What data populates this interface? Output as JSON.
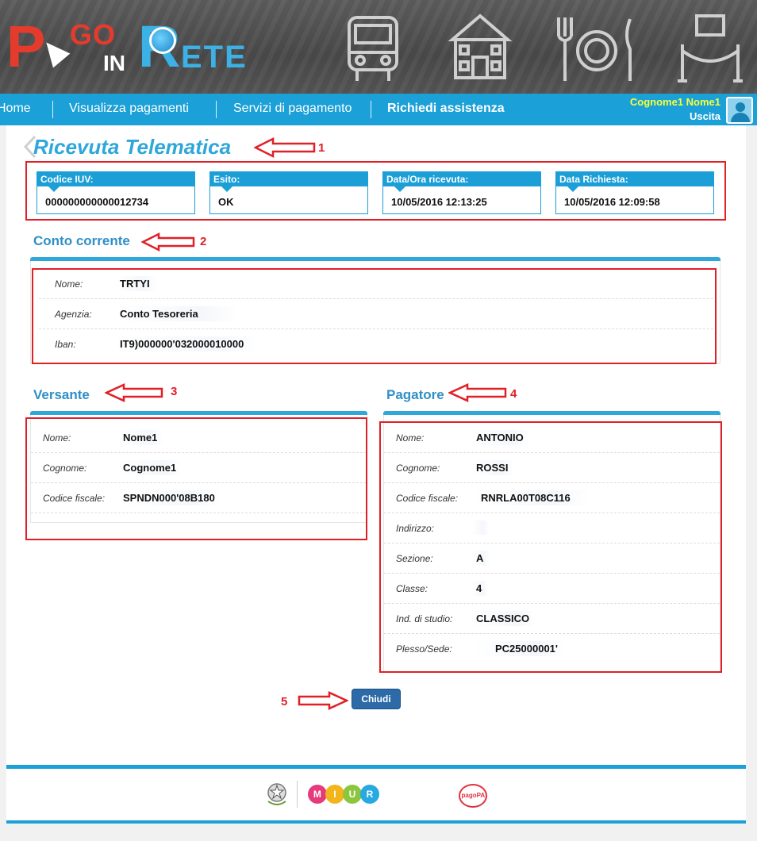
{
  "brand": {
    "p": "P",
    "go": "GO",
    "in": "IN",
    "r": "R",
    "ete": "ETE"
  },
  "nav": {
    "home": "Home",
    "visualizza": "Visualizza pagamenti",
    "servizi": "Servizi di pagamento",
    "assistenza": "Richiedi assistenza"
  },
  "user": {
    "name": "Cognome1 Nome1",
    "exit": "Uscita"
  },
  "page": {
    "title": "Ricevuta Telematica"
  },
  "summary": [
    {
      "label": "Codice IUV:",
      "value": "000000000000012734"
    },
    {
      "label": "Esito:",
      "value": "OK"
    },
    {
      "label": "Data/Ora ricevuta:",
      "value": "10/05/2016 12:13:25"
    },
    {
      "label": "Data Richiesta:",
      "value": "10/05/2016 12:09:58"
    }
  ],
  "conto": {
    "title": "Conto corrente",
    "rows": [
      {
        "label": "Nome:",
        "value": "TRTYI"
      },
      {
        "label": "Agenzia:",
        "value": "Conto Tesoreria"
      },
      {
        "label": "Iban:",
        "value": "IT9)000000'032000010000"
      }
    ]
  },
  "versante": {
    "title": "Versante",
    "rows": [
      {
        "label": "Nome:",
        "value": "Nome1"
      },
      {
        "label": "Cognome:",
        "value": "Cognome1"
      },
      {
        "label": "Codice fiscale:",
        "value": "SPNDN000'08B180"
      }
    ]
  },
  "pagatore": {
    "title": "Pagatore",
    "rows": [
      {
        "label": "Nome:",
        "value": "ANTONIO"
      },
      {
        "label": "Cognome:",
        "value": "ROSSI"
      },
      {
        "label": "Codice fiscale:",
        "value": "RNRLA00T08C116"
      },
      {
        "label": "Indirizzo:",
        "value": ""
      },
      {
        "label": "Sezione:",
        "value": "A"
      },
      {
        "label": "Classe:",
        "value": "4"
      },
      {
        "label": "Ind. di studio:",
        "value": "CLASSICO"
      },
      {
        "label": "Plesso/Sede:",
        "value": "PC25000001'"
      }
    ]
  },
  "buttons": {
    "close": "Chiudi"
  },
  "annotations": [
    "1",
    "2",
    "3",
    "4",
    "5"
  ],
  "footer": {
    "miur_letters": [
      "M",
      "I",
      "U",
      "R"
    ],
    "pagopa": "pagoPA"
  },
  "colors": {
    "accent": "#1ba0d7",
    "title": "#2fa7d9",
    "annotation": "#e02027",
    "user": "#f8ff3a",
    "button": "#2c6aa8"
  }
}
